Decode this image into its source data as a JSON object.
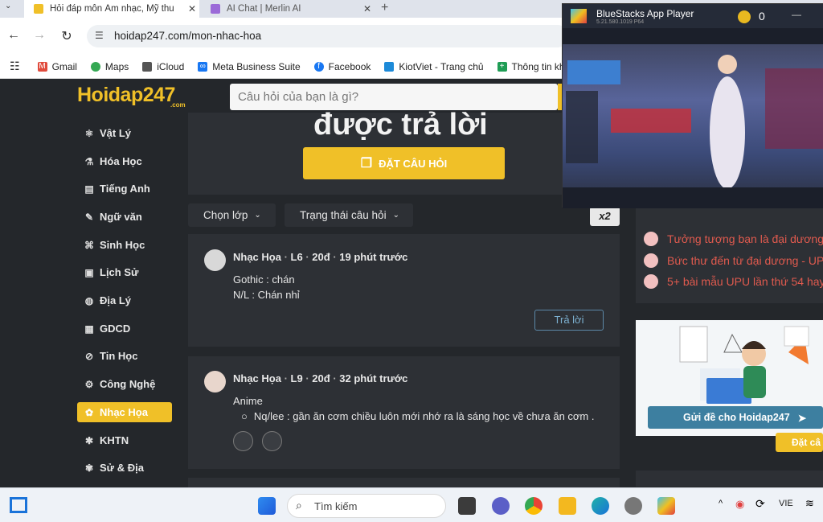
{
  "browser": {
    "tabs": [
      {
        "title": "Hỏi đáp môn Âm nhạc, Mỹ thu"
      },
      {
        "title": "AI Chat | Merlin AI"
      }
    ],
    "new_tab": "+",
    "url": "hoidap247.com/mon-nhac-hoa",
    "bookmarks": [
      "Gmail",
      "Maps",
      "iCloud",
      "Meta Business Suite",
      "Facebook",
      "KiotViet - Trang chủ",
      "Thông tin khách h"
    ]
  },
  "site": {
    "logo": "Hoidap247",
    "logo_sub": ".com",
    "search_placeholder": "Câu hỏi của bạn là gì?",
    "sidebar": [
      {
        "label": "Vật Lý",
        "icon": "atom-icon"
      },
      {
        "label": "Hóa Học",
        "icon": "flask-icon"
      },
      {
        "label": "Tiếng Anh",
        "icon": "language-icon"
      },
      {
        "label": "Ngữ văn",
        "icon": "pen-icon"
      },
      {
        "label": "Sinh Học",
        "icon": "dna-icon"
      },
      {
        "label": "Lịch Sử",
        "icon": "scroll-icon"
      },
      {
        "label": "Địa Lý",
        "icon": "globe-icon"
      },
      {
        "label": "GDCD",
        "icon": "book-icon"
      },
      {
        "label": "Tin Học",
        "icon": "computer-icon"
      },
      {
        "label": "Công Nghệ",
        "icon": "gear-icon"
      },
      {
        "label": "Nhạc Họa",
        "icon": "palette-icon",
        "active": true
      },
      {
        "label": "KHTN",
        "icon": "molecule-icon"
      },
      {
        "label": "Sử & Địa",
        "icon": "map-icon"
      }
    ],
    "hero_title": "được trả lời",
    "ask_button": "ĐẶT CÂU HỎI",
    "filters": {
      "class": "Chọn lớp",
      "status": "Trạng thái câu hỏi"
    },
    "multiplier": "x2",
    "posts": [
      {
        "subject": "Nhạc Họa",
        "level": "L6",
        "points": "20đ",
        "time": "19 phút trước",
        "lines": [
          "Gothic : chán",
          "N/L : Chán nhỉ"
        ],
        "reply": "Trả lời"
      },
      {
        "subject": "Nhạc Họa",
        "level": "L9",
        "points": "20đ",
        "time": "32 phút trước",
        "lines": [
          "Anime"
        ],
        "bullet": "Nq/lee : gần ăn cơm chiều luôn mới nhớ ra là sáng học về chưa ăn cơm ..."
      }
    ],
    "right_links": [
      "Tưởng tượng bạn là đại dương...",
      "Bức thư đến từ đại dương - UPU",
      "5+ bài mẫu UPU lần thứ 54 hay"
    ],
    "send_button": "Gửi đề cho Hoidap247",
    "dat_ca": "Đặt câ"
  },
  "bluestacks": {
    "title": "BlueStacks App Player",
    "version": "5.21.580.1019 P64",
    "coins": "0"
  },
  "taskbar": {
    "search": "Tìm kiếm",
    "lang": "VIE"
  },
  "colors": {
    "accent": "#f0c028",
    "bg": "#24272b",
    "card": "#2d3035",
    "link_red": "#e05a4e"
  }
}
